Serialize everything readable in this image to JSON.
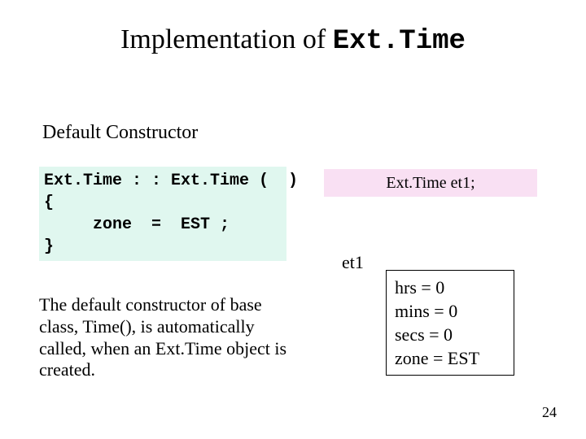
{
  "title": {
    "prefix": "Implementation of ",
    "code": "Ext.Time"
  },
  "subhead": "Default Constructor",
  "code": {
    "line1": "Ext.Time : : Ext.Time (  )",
    "line2": "{",
    "line3": "     zone  =  EST ;",
    "line4": "}"
  },
  "explain": "The default constructor of base class, Time(), is automatically called, when an Ext.Time object is created.",
  "declaration": "Ext.Time et1;",
  "object": {
    "label": "et1",
    "fields": {
      "f1": "hrs = 0",
      "f2": "mins = 0",
      "f3": "secs = 0",
      "f4": "zone = EST"
    }
  },
  "page_number": "24"
}
